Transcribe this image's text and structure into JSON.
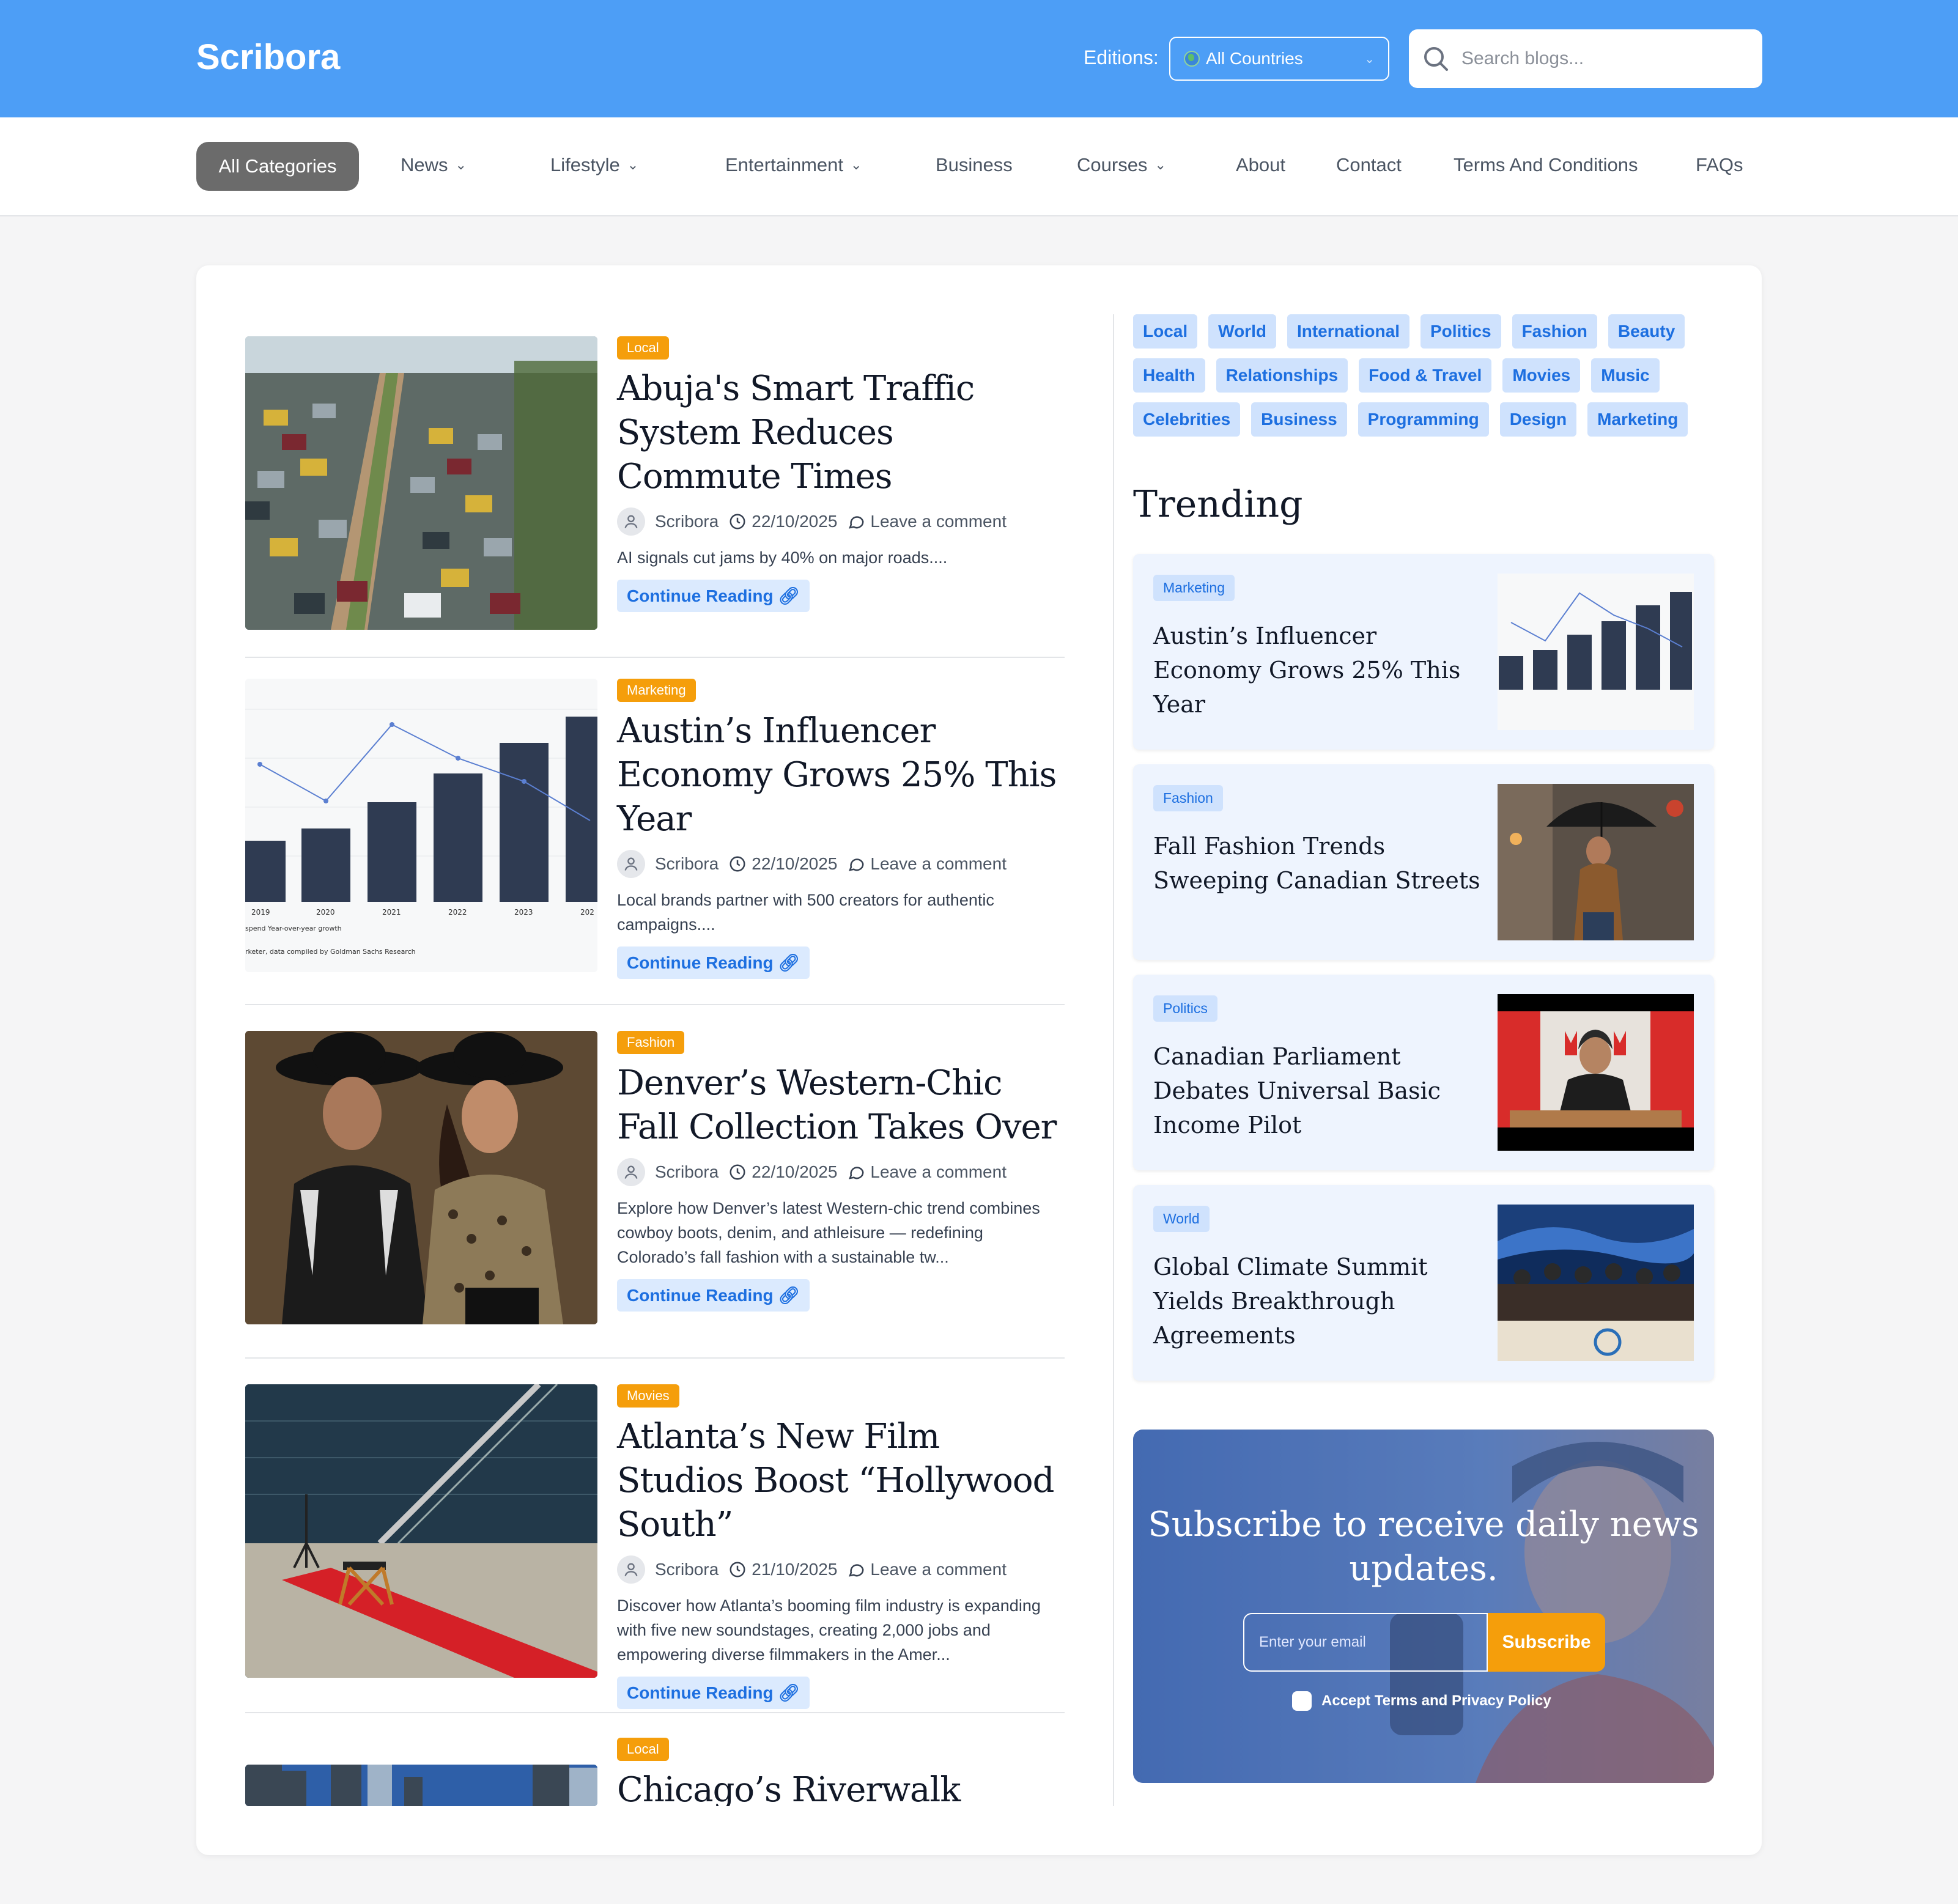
{
  "header": {
    "logo": "Scribora",
    "editions_label": "Editions:",
    "editions_value": "All Countries",
    "search_placeholder": "Search blogs..."
  },
  "nav": {
    "active": "All Categories",
    "items": [
      {
        "label": "News",
        "dropdown": true
      },
      {
        "label": "Lifestyle",
        "dropdown": true
      },
      {
        "label": "Entertainment",
        "dropdown": true
      },
      {
        "label": "Business",
        "dropdown": false
      },
      {
        "label": "Courses",
        "dropdown": true
      },
      {
        "label": "About",
        "dropdown": false
      },
      {
        "label": "Contact",
        "dropdown": false
      },
      {
        "label": "Terms And Conditions",
        "dropdown": false
      },
      {
        "label": "FAQs",
        "dropdown": false
      }
    ]
  },
  "articles": [
    {
      "category": "Local",
      "title": "Abuja's Smart Traffic System Reduces Commute Times",
      "author": "Scribora",
      "date": "22/10/2025",
      "comments": "Leave a comment",
      "excerpt": "AI signals cut jams by 40% on major roads....",
      "read_more": "Continue Reading"
    },
    {
      "category": "Marketing",
      "title": "Austin’s Influencer Economy Grows 25% This Year",
      "author": "Scribora",
      "date": "22/10/2025",
      "comments": "Leave a comment",
      "excerpt": "Local brands partner with 500 creators for authentic campaigns....",
      "read_more": "Continue Reading"
    },
    {
      "category": "Fashion",
      "title": "Denver’s Western-Chic Fall Collection Takes Over",
      "author": "Scribora",
      "date": "22/10/2025",
      "comments": "Leave a comment",
      "excerpt": "Explore how Denver’s latest Western-chic trend combines cowboy boots, denim, and athleisure — redefining Colorado’s fall fashion with a sustainable tw...",
      "read_more": "Continue Reading"
    },
    {
      "category": "Movies",
      "title": "Atlanta’s New Film Studios Boost “Hollywood South”",
      "author": "Scribora",
      "date": "21/10/2025",
      "comments": "Leave a comment",
      "excerpt": "Discover how Atlanta’s booming film industry is expanding with five new soundstages, creating 2,000 jobs and empowering diverse filmmakers in the Amer...",
      "read_more": "Continue Reading"
    },
    {
      "category": "Local",
      "title": "Chicago’s Riverwalk"
    }
  ],
  "chart_thumb": {
    "years": [
      "2019",
      "2020",
      "2021",
      "2022",
      "2023",
      "202"
    ],
    "legend": "spend  Year-over-year growth",
    "source": "rketer, data compiled by Goldman Sachs Research"
  },
  "tags": [
    "Local",
    "World",
    "International",
    "Politics",
    "Fashion",
    "Beauty",
    "Health",
    "Relationships",
    "Food & Travel",
    "Movies",
    "Music",
    "Celebrities",
    "Business",
    "Programming",
    "Design",
    "Marketing"
  ],
  "trending": {
    "title": "Trending",
    "items": [
      {
        "category": "Marketing",
        "title": "Austin’s Influencer Economy Grows 25% This Year"
      },
      {
        "category": "Fashion",
        "title": "Fall Fashion Trends Sweeping Canadian Streets"
      },
      {
        "category": "Politics",
        "title": "Canadian Parliament Debates Universal Basic Income Pilot"
      },
      {
        "category": "World",
        "title": "Global Climate Summit Yields Breakthrough Agreements"
      }
    ]
  },
  "subscribe": {
    "title": "Subscribe to receive daily news updates.",
    "email_placeholder": "Enter your email",
    "button": "Subscribe",
    "consent": "Accept Terms and Privacy Policy"
  },
  "colors": {
    "header_bg": "#4d9ef6",
    "category_pill": "#f59e0b",
    "tag_bg": "#cfe2fd",
    "link_blue": "#1d6fe0"
  }
}
